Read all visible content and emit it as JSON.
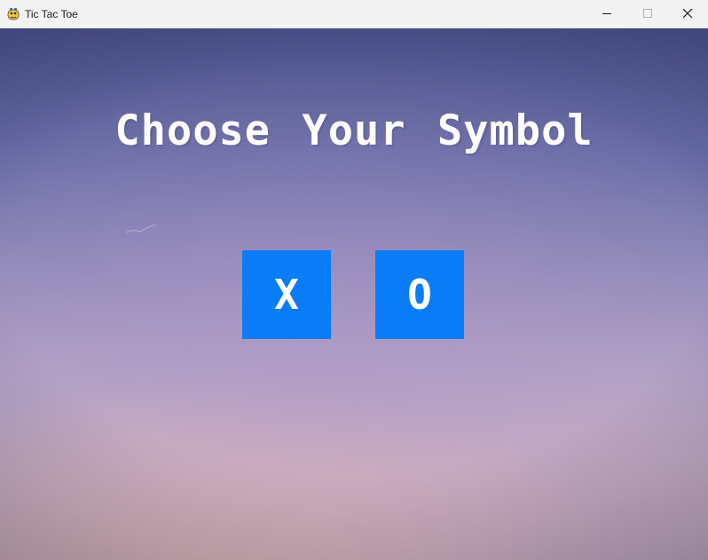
{
  "window": {
    "title": "Tic Tac Toe",
    "app_icon": "python-snake-icon",
    "controls": {
      "minimize_icon": "minimize-icon",
      "maximize_icon": "maximize-icon",
      "close_icon": "close-icon"
    }
  },
  "game": {
    "heading": "Choose Your Symbol",
    "buttons": {
      "x_label": "X",
      "o_label": "O"
    },
    "colors": {
      "button": "#0a7cf7",
      "button_text": "#ffffff",
      "heading_text": "#ffffff"
    }
  }
}
